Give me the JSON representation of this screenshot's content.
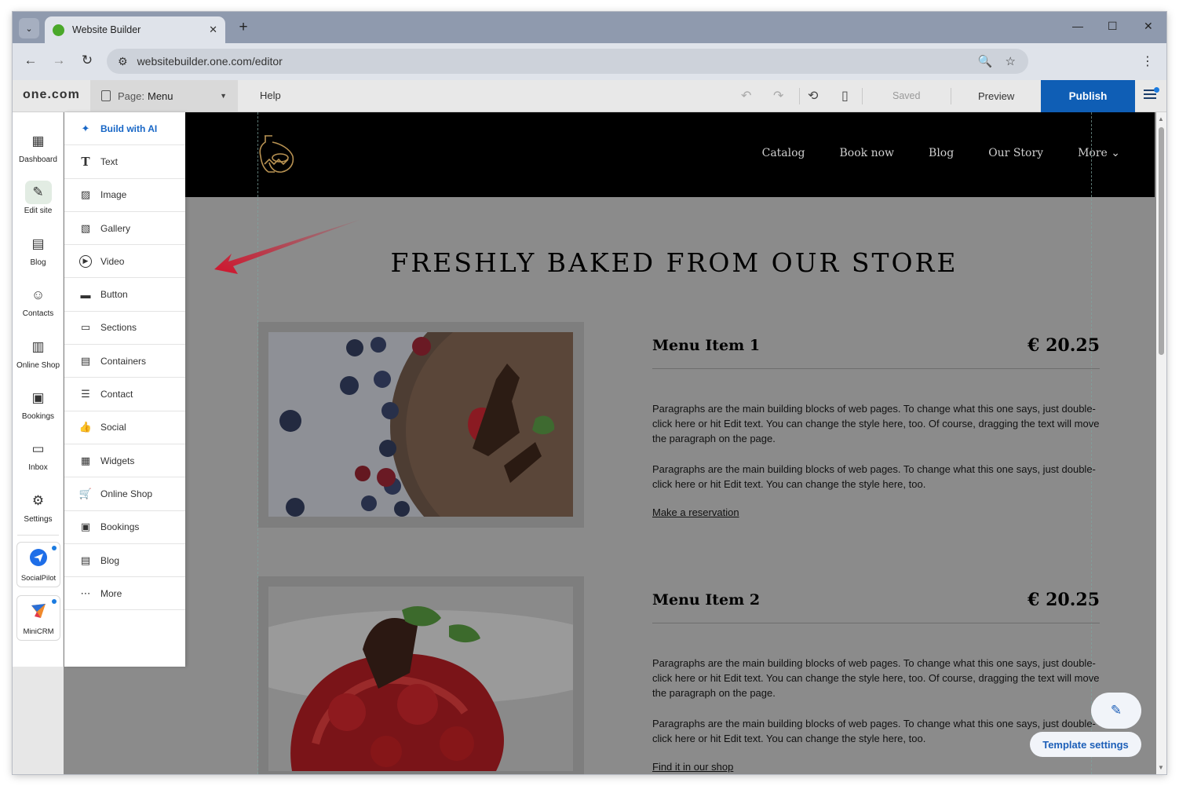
{
  "browser": {
    "tab_title": "Website Builder",
    "url": "websitebuilder.one.com/editor",
    "tab_close": "✕",
    "new_tab": "+",
    "controls": {
      "minimize": "—",
      "maximize": "☐",
      "close": "✕"
    }
  },
  "appbar": {
    "logo": "one.com",
    "page_prefix": "Page:",
    "page_value": "Menu",
    "help": "Help",
    "saved": "Saved",
    "preview": "Preview",
    "publish": "Publish"
  },
  "rail": {
    "items": [
      {
        "label": "Dashboard",
        "icon": "dashboard-icon",
        "glyph": "▦"
      },
      {
        "label": "Edit site",
        "icon": "edit-site-icon",
        "glyph": "✎"
      },
      {
        "label": "Blog",
        "icon": "blog-icon",
        "glyph": "▤"
      },
      {
        "label": "Contacts",
        "icon": "contacts-icon",
        "glyph": "☺"
      },
      {
        "label": "Online Shop",
        "icon": "shop-icon",
        "glyph": "▥"
      },
      {
        "label": "Bookings",
        "icon": "bookings-icon",
        "glyph": "▣"
      },
      {
        "label": "Inbox",
        "icon": "inbox-icon",
        "glyph": "▭"
      },
      {
        "label": "Settings",
        "icon": "settings-icon",
        "glyph": "⚙"
      }
    ],
    "apps": [
      {
        "label": "SocialPilot",
        "icon": "socialpilot-icon"
      },
      {
        "label": "MiniCRM",
        "icon": "minicrm-icon"
      }
    ]
  },
  "add_panel": {
    "items": [
      {
        "label": "Build with AI",
        "icon": "sparkle-icon",
        "glyph": "✦"
      },
      {
        "label": "Text",
        "icon": "text-icon",
        "glyph": "T"
      },
      {
        "label": "Image",
        "icon": "image-icon",
        "glyph": "▨"
      },
      {
        "label": "Gallery",
        "icon": "gallery-icon",
        "glyph": "▧"
      },
      {
        "label": "Video",
        "icon": "video-icon",
        "glyph": "▶"
      },
      {
        "label": "Button",
        "icon": "button-icon",
        "glyph": "▬"
      },
      {
        "label": "Sections",
        "icon": "sections-icon",
        "glyph": "▭"
      },
      {
        "label": "Containers",
        "icon": "containers-icon",
        "glyph": "▤"
      },
      {
        "label": "Contact",
        "icon": "contact-form-icon",
        "glyph": "☰"
      },
      {
        "label": "Social",
        "icon": "social-icon",
        "glyph": "👍"
      },
      {
        "label": "Widgets",
        "icon": "widgets-icon",
        "glyph": "▦"
      },
      {
        "label": "Online Shop",
        "icon": "cart-icon",
        "glyph": "🛒"
      },
      {
        "label": "Bookings",
        "icon": "bookings-icon",
        "glyph": "▣"
      },
      {
        "label": "Blog",
        "icon": "blog-icon",
        "glyph": "▤"
      },
      {
        "label": "More",
        "icon": "more-icon",
        "glyph": "⋯"
      }
    ]
  },
  "site": {
    "nav": [
      "Catalog",
      "Book now",
      "Blog",
      "Our Story",
      "More ⌄"
    ],
    "hero_title": "FRESHLY BAKED FROM OUR STORE",
    "menu_items": [
      {
        "name": "Menu Item 1",
        "price": "€ 20.25",
        "para1": "Paragraphs are the main building blocks of web pages. To change what this one says, just double-click here or hit Edit text. You can change the style here, too. Of course, dragging the text will move the paragraph on the page.",
        "para2": "Paragraphs are the main building blocks of web pages. To change what this one says, just double-click here or hit Edit text. You can change the style here, too.",
        "link": "Make a reservation"
      },
      {
        "name": "Menu Item 2",
        "price": "€ 20.25",
        "para1": "Paragraphs are the main building blocks of web pages. To change what this one says, just double-click here or hit Edit text. You can change the style here, too. Of course, dragging the text will move the paragraph on the page.",
        "para2": "Paragraphs are the main building blocks of web pages. To change what this one says, just double-click here or hit Edit text. You can change the style here, too.",
        "link": "Find it in our shop"
      }
    ]
  },
  "template_settings": "Template settings",
  "colors": {
    "publish": "#0f5eb5",
    "accent_blue": "#1766c6",
    "arrow": "#d0142c",
    "header_bg": "#000000"
  }
}
